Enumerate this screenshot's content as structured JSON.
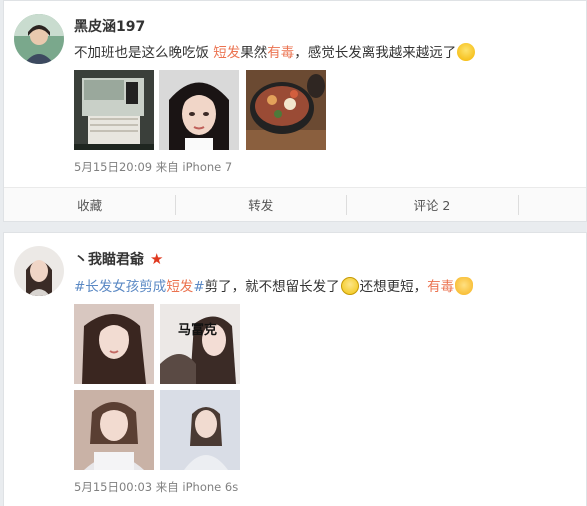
{
  "posts": [
    {
      "username": "黑皮涵197",
      "text_parts": [
        "不加班也是这么晚吃饭 ",
        "短发",
        "果然",
        "有毒",
        "，感觉长发离我越来越远了"
      ],
      "meta": "5月15日20:09 来自 iPhone 7",
      "actions": [
        "收藏",
        "转发",
        "评论 2",
        ""
      ]
    },
    {
      "username": "丶我瞄君爺",
      "text_parts": [
        "#长发女孩剪成",
        "短发",
        "#",
        "剪了，就不想留长发了",
        "还想更短，",
        "有毒"
      ],
      "meta": "5月15日00:03 来自 iPhone 6s"
    }
  ],
  "icons": {
    "star": "★",
    "vip_badge": "vip-star-icon",
    "emoji_lol": "laugh-cry-emoji-icon",
    "emoji_smile": "smile-emoji-icon",
    "emoji_cat": "cat-emoji-icon"
  },
  "colors": {
    "highlight": "#eb7350",
    "topic": "#5b89c4",
    "meta": "#808080"
  }
}
